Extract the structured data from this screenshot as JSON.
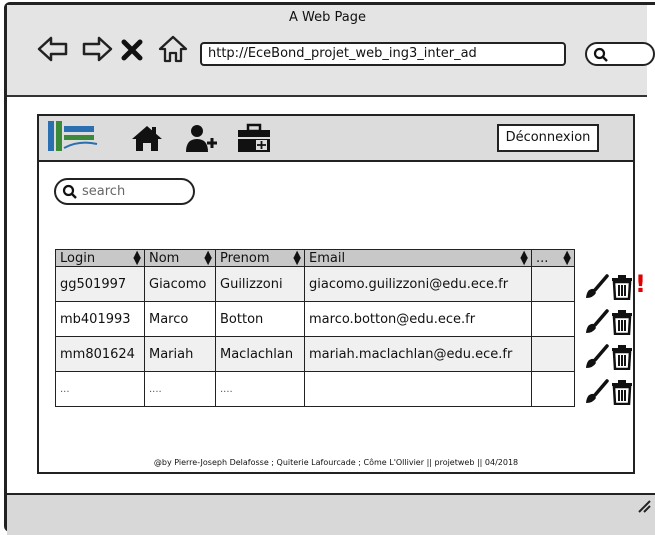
{
  "browser": {
    "title": "A Web Page",
    "url": "http://EceBond_projet_web_ing3_inter_ad",
    "icons": [
      "back-arrow-icon",
      "forward-arrow-icon",
      "close-icon",
      "home-icon",
      "search-icon"
    ]
  },
  "toolbar": {
    "logo_icon": "ecebond-logo",
    "icons": [
      "home-icon",
      "add-user-icon",
      "briefcase-icon"
    ],
    "logout_label": "Déconnexion"
  },
  "search": {
    "placeholder": "search"
  },
  "table": {
    "columns": [
      "Login",
      "Nom",
      "Prenom",
      "Email",
      "..."
    ],
    "rows": [
      {
        "login": "gg501997",
        "nom": "Giacomo",
        "prenom": "Guilizzoni",
        "email": "giacomo.guilizzoni@edu.ece.fr",
        "extra": "",
        "alert": "!"
      },
      {
        "login": "mb401993",
        "nom": "Marco",
        "prenom": "Botton",
        "email": "marco.botton@edu.ece.fr",
        "extra": ""
      },
      {
        "login": "mm801624",
        "nom": "Mariah",
        "prenom": "Maclachlan",
        "email": "mariah.maclachlan@edu.ece.fr",
        "extra": ""
      },
      {
        "login": "...",
        "nom": "....",
        "prenom": "....",
        "email": "",
        "extra": ""
      }
    ],
    "row_action_icons": [
      "brush-icon",
      "trash-icon"
    ],
    "alert_color": "#e00000"
  },
  "footer": {
    "text": "@by Pierre-Joseph Delafosse ; Quiterie Lafourcade ; Côme L'Ollivier || projetweb || 04/2018"
  }
}
